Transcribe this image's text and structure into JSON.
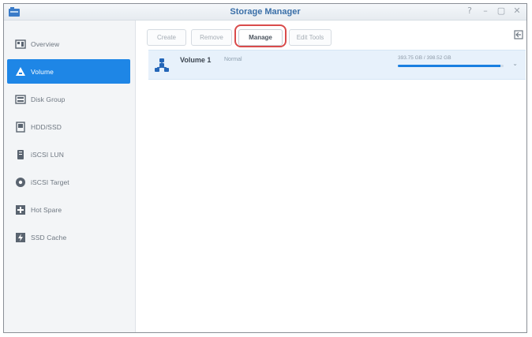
{
  "window": {
    "title": "Storage Manager",
    "controls": [
      "?",
      "–",
      "▢",
      "✕"
    ]
  },
  "sidebar": {
    "items": [
      {
        "label": "Overview",
        "icon": "overview-icon"
      },
      {
        "label": "Volume",
        "icon": "volume-icon",
        "active": true
      },
      {
        "label": "Disk Group",
        "icon": "disk-group-icon"
      },
      {
        "label": "HDD/SSD",
        "icon": "hdd-icon"
      },
      {
        "label": "iSCSI LUN",
        "icon": "iscsi-lun-icon"
      },
      {
        "label": "iSCSI Target",
        "icon": "iscsi-target-icon"
      },
      {
        "label": "Hot Spare",
        "icon": "hot-spare-icon"
      },
      {
        "label": "SSD Cache",
        "icon": "ssd-cache-icon"
      }
    ]
  },
  "toolbar": {
    "buttons": [
      {
        "label": "Create"
      },
      {
        "label": "Remove"
      },
      {
        "label": "Manage"
      },
      {
        "label": "Edit Tools"
      }
    ]
  },
  "volumes": [
    {
      "name": "Volume 1",
      "status": "Normal",
      "usage_text": "393.75 GB / 398.52 GB",
      "used_fraction": 0.97
    }
  ],
  "colors": {
    "accent": "#1e86e6",
    "highlight": "#d94b4b",
    "row_bg": "#e7f1fb"
  }
}
